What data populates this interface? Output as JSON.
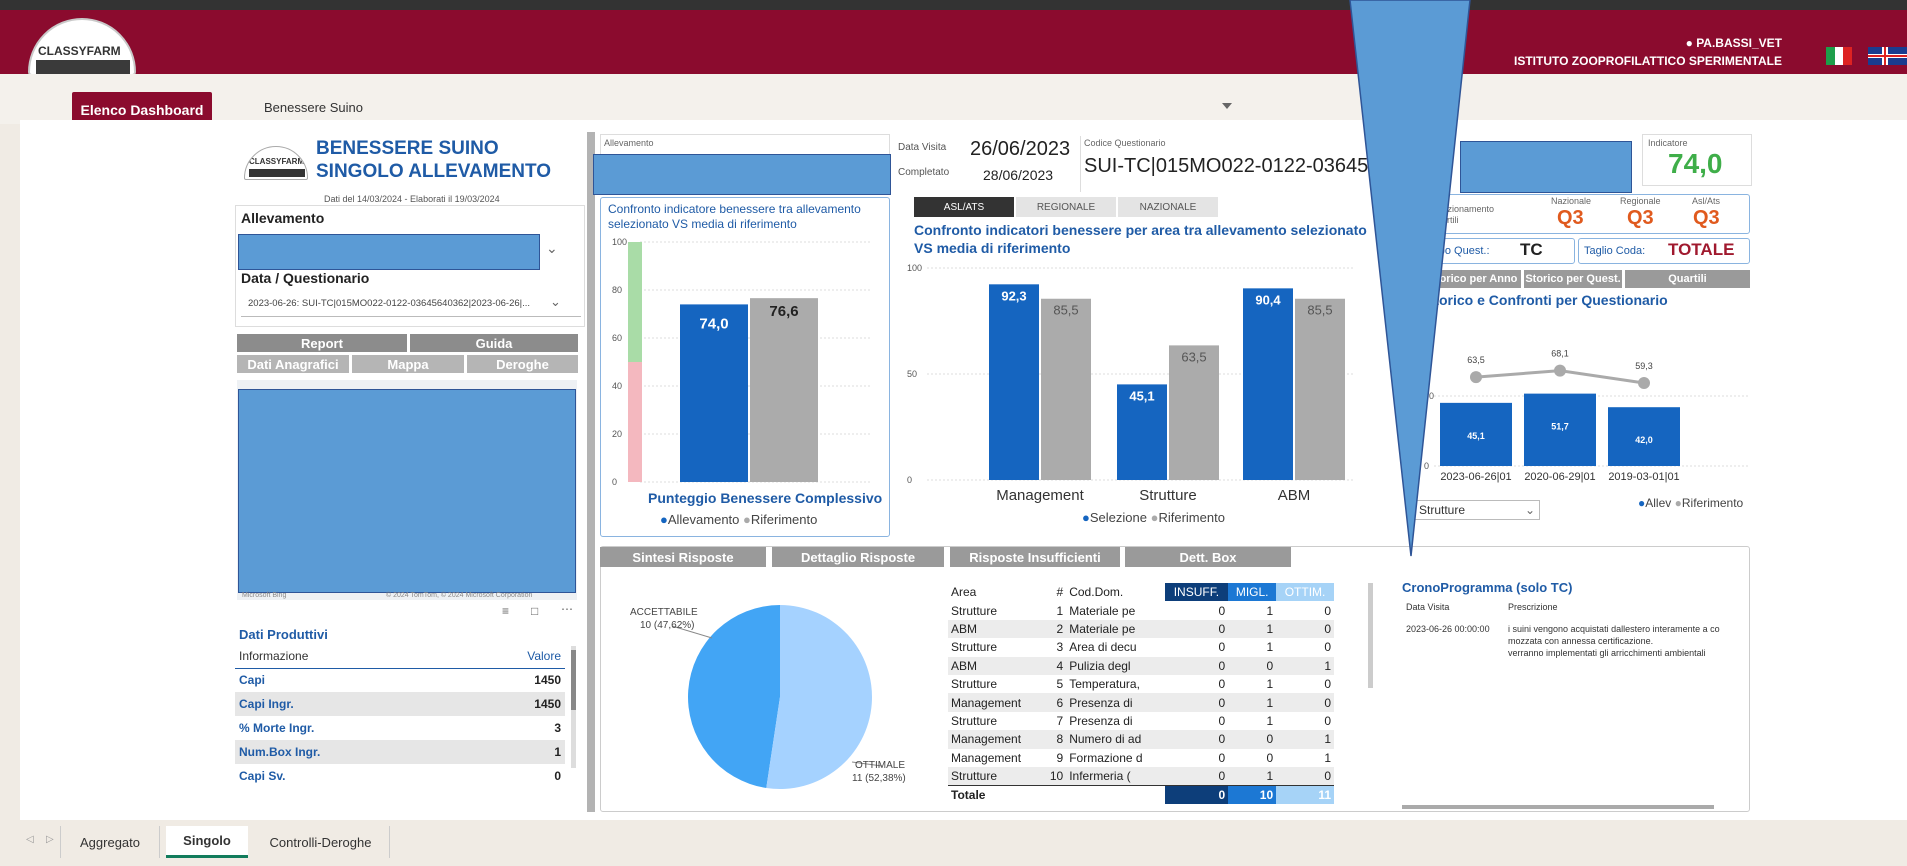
{
  "header": {
    "logo_text": "CLASSYFARM",
    "user": "PA.BASSI_VET",
    "institute": "ISTITUTO ZOOPROFILATTICO SPERIMENTALE",
    "user_icon": "user-icon"
  },
  "nav": {
    "dashboard_button": "Elenco Dashboard",
    "selected_dashboard": "Benessere Suino"
  },
  "left": {
    "title_line1": "BENESSERE SUINO",
    "title_line2": "SINGOLO ALLEVAMENTO",
    "dates_note": "Dati del 14/03/2024 - Elaborati il 19/03/2024",
    "allevamento_label": "Allevamento",
    "data_label": "Data / Questionario",
    "questionario_value": "2023-06-26: SUI-TC|015MO022-0122-03645640362|2023-06-26|...",
    "buttons": {
      "report": "Report",
      "guida": "Guida",
      "dati_anagrafici": "Dati Anagrafici",
      "mappa": "Mappa",
      "deroghe": "Deroghe"
    },
    "map_credits_left": "Microsoft Bing",
    "map_credits_right": "© 2024 TomTom, © 2024 Microsoft Corporation",
    "produttivi_title": "Dati Produttivi",
    "produttivi_headers": [
      "Informazione",
      "Valore"
    ],
    "produttivi_rows": [
      {
        "info": "Capi",
        "valore": "1450"
      },
      {
        "info": "Capi Ingr.",
        "valore": "1450"
      },
      {
        "info": "% Morte Ingr.",
        "valore": "3"
      },
      {
        "info": "Num.Box Ingr.",
        "valore": "1"
      },
      {
        "info": "Capi Sv.",
        "valore": "0"
      }
    ]
  },
  "top_info": {
    "allevamento_label": "Allevamento",
    "data_visita_label": "Data Visita",
    "data_visita": "26/06/2023",
    "completato_label": "Completato",
    "completato": "28/06/2023",
    "codice_label": "Codice Questionario",
    "codice": "SUI-TC|015MO022-0122-0364564",
    "indicatore_label": "Indicatore",
    "indicatore": "74,0"
  },
  "chart1": {
    "title": "Confronto indicatore benessere tra allevamento selezionato VS media di riferimento",
    "xlabel": "Punteggio Benessere Complessivo",
    "legend": [
      "Allevamento",
      "Riferimento"
    ]
  },
  "chart2": {
    "tabs": [
      "ASL/ATS",
      "REGIONALE",
      "NAZIONALE"
    ],
    "title": "Confronto indicatori benessere per area tra allevamento selezionato VS media di riferimento",
    "legend": [
      "Selezione",
      "Riferimento"
    ]
  },
  "right": {
    "posizionamento": "Posizionamento Quartili",
    "col_headers": [
      "Nazionale",
      "Regionale",
      "Asl/Ats"
    ],
    "quartili": [
      "Q3",
      "Q3",
      "Q3"
    ],
    "tipo_quest_label": "Tipo Quest.:",
    "tipo_quest": "TC",
    "taglio_label": "Taglio Coda:",
    "taglio": "TOTALE",
    "tabs": [
      "Storico per Anno",
      "Storico per Quest.",
      "Quartili"
    ],
    "title": "Storico e Confronti per Questionario",
    "dropdown": "Strutture",
    "legend": [
      "Allev",
      "Riferimento"
    ]
  },
  "bottom": {
    "tabs": [
      "Sintesi Risposte",
      "Dettaglio Risposte",
      "Risposte Insufficienti",
      "Dett. Box"
    ],
    "table_headers": [
      "Area",
      "#",
      "Cod.Dom.",
      "INSUFF.",
      "MIGL.",
      "OTTIM."
    ],
    "rows": [
      {
        "area": "Strutture",
        "n": "1",
        "cod": "Materiale pe",
        "i": "0",
        "m": "1",
        "o": "0"
      },
      {
        "area": "ABM",
        "n": "2",
        "cod": "Materiale pe",
        "i": "0",
        "m": "1",
        "o": "0"
      },
      {
        "area": "Strutture",
        "n": "3",
        "cod": "Area di decu",
        "i": "0",
        "m": "1",
        "o": "0"
      },
      {
        "area": "ABM",
        "n": "4",
        "cod": "Pulizia degl",
        "i": "0",
        "m": "0",
        "o": "1"
      },
      {
        "area": "Strutture",
        "n": "5",
        "cod": "Temperatura,",
        "i": "0",
        "m": "1",
        "o": "0"
      },
      {
        "area": "Management",
        "n": "6",
        "cod": "Presenza di",
        "i": "0",
        "m": "1",
        "o": "0"
      },
      {
        "area": "Strutture",
        "n": "7",
        "cod": "Presenza di",
        "i": "0",
        "m": "1",
        "o": "0"
      },
      {
        "area": "Management",
        "n": "8",
        "cod": "Numero di ad",
        "i": "0",
        "m": "0",
        "o": "1"
      },
      {
        "area": "Management",
        "n": "9",
        "cod": "Formazione d",
        "i": "0",
        "m": "0",
        "o": "1"
      },
      {
        "area": "Strutture",
        "n": "10",
        "cod": "Infermeria (",
        "i": "0",
        "m": "1",
        "o": "0"
      }
    ],
    "total": {
      "label": "Totale",
      "i": "0",
      "m": "10",
      "o": "11"
    },
    "pie_labels": {
      "acc": "ACCETTABILE",
      "acc_val": "10 (47,62%)",
      "ott": "OTTIMALE",
      "ott_val": "11 (52,38%)"
    },
    "crono_title": "CronoProgramma (solo TC)",
    "crono_headers": [
      "Data Visita",
      "Prescrizione"
    ],
    "crono_date": "2023-06-26 00:00:00",
    "crono_text1": "i suini vengono acquistati dallestero interamente a co",
    "crono_text2": "mozzata con annessa certificazione.",
    "crono_text3": "verranno implementati gli arricchimenti ambientali"
  },
  "tabs_bottom": [
    "Aggregato",
    "Singolo",
    "Controlli-Deroghe"
  ],
  "chart_data": [
    {
      "type": "bar",
      "title": "Confronto indicatore benessere tra allevamento selezionato VS media di riferimento",
      "xlabel": "Punteggio Benessere Complessivo",
      "ylabel": "",
      "ylim": [
        0,
        100
      ],
      "yticks": [
        0,
        20,
        40,
        60,
        80,
        100
      ],
      "categories": [
        ""
      ],
      "series": [
        {
          "name": "Allevamento",
          "values": [
            74.0
          ]
        },
        {
          "name": "Riferimento",
          "values": [
            76.6
          ]
        }
      ],
      "value_labels": [
        "74,0",
        "76,6"
      ],
      "legend_position": "bottom",
      "colors": {
        "Allevamento": "#1565c0",
        "Riferimento": "#ababab"
      }
    },
    {
      "type": "bar",
      "title": "Confronto indicatori benessere per area tra allevamento selezionato VS media di riferimento",
      "ylim": [
        0,
        100
      ],
      "yticks": [
        0,
        50,
        100
      ],
      "categories": [
        "Management",
        "Strutture",
        "ABM"
      ],
      "series": [
        {
          "name": "Selezione",
          "values": [
            92.3,
            45.1,
            90.4
          ]
        },
        {
          "name": "Riferimento",
          "values": [
            85.5,
            63.5,
            85.5
          ]
        }
      ],
      "value_labels": {
        "Selezione": [
          "92,3",
          "45,1",
          "90,4"
        ],
        "Riferimento": [
          "85,5",
          "63,5",
          "85,5"
        ]
      },
      "legend_position": "bottom"
    },
    {
      "type": "bar",
      "title": "Storico e Confronti per Questionario",
      "categories": [
        "2023-06-26|01",
        "2020-06-29|01",
        "2019-03-01|01"
      ],
      "series": [
        {
          "name": "Allev",
          "values": [
            45.1,
            51.7,
            42.0
          ]
        },
        {
          "name": "Riferimento",
          "values": [
            63.5,
            68.1,
            59.3
          ]
        }
      ],
      "value_labels": {
        "Allev": [
          "45,1",
          "51,7",
          "42,0"
        ],
        "Riferimento": [
          "63,5",
          "68,1",
          "59,3"
        ]
      },
      "yticks": [
        0,
        50
      ],
      "legend_position": "bottom-right"
    },
    {
      "type": "pie",
      "slices": [
        {
          "label": "ACCETTABILE",
          "value": 10,
          "pct": "47,62%",
          "color": "#42a5f5"
        },
        {
          "label": "OTTIMALE",
          "value": 11,
          "pct": "52,38%",
          "color": "#a5d2ff"
        }
      ]
    }
  ]
}
